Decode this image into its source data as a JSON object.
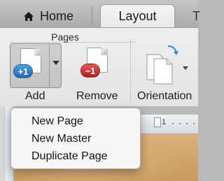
{
  "tabs": {
    "home": {
      "label": "Home",
      "icon": "home-icon"
    },
    "layout": {
      "label": "Layout"
    },
    "next": {
      "label": "T"
    }
  },
  "ribbon": {
    "group_label": "Pages",
    "add": {
      "label": "Add",
      "badge": "+1",
      "badge_color": "#2b7bd0"
    },
    "remove": {
      "label": "Remove",
      "badge": "−1",
      "badge_color": "#c62c2c"
    },
    "orientation": {
      "label": "Orientation"
    }
  },
  "ruler": {
    "label": "1"
  },
  "menu": {
    "items": [
      {
        "label": "New Page"
      },
      {
        "label": "New Master"
      },
      {
        "label": "Duplicate Page"
      }
    ]
  }
}
